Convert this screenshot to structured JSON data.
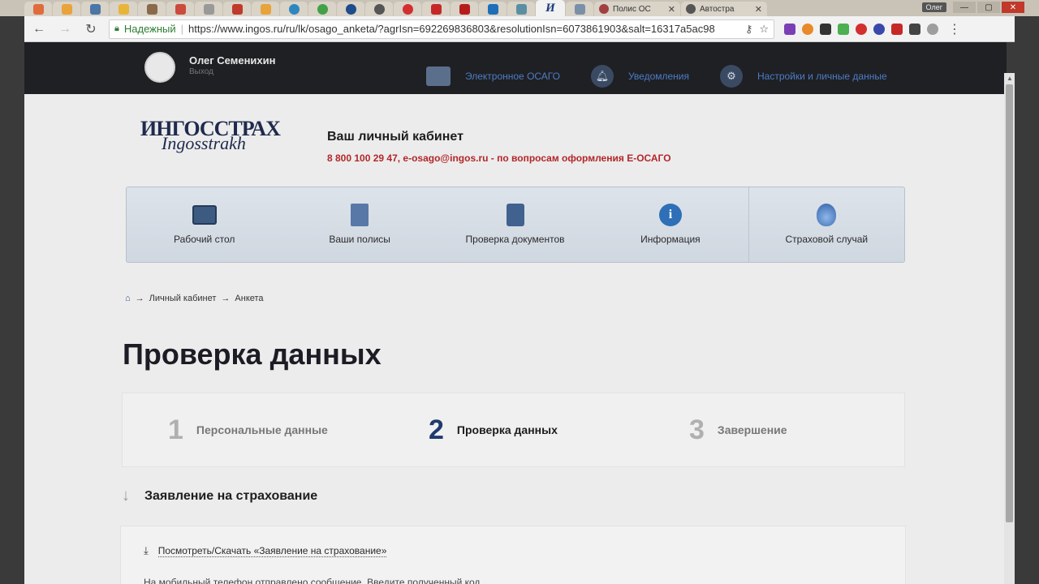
{
  "browser": {
    "tabs": [
      {
        "title": "Полис ОС"
      },
      {
        "title": "Автостра"
      }
    ],
    "active_tab_letter": "И",
    "user_badge": "Олег",
    "security_label": "Надежный",
    "url": "https://www.ingos.ru/ru/lk/osago_anketa/?agrIsn=692269836803&resolutionIsn=6073861903&salt=16317a5ac98"
  },
  "topbar": {
    "user_name": "Олег Семенихин",
    "logout": "Выход",
    "links": [
      {
        "label": "Электронное ОСАГО"
      },
      {
        "label": "Уведомления"
      },
      {
        "label": "Настройки и личные данные"
      }
    ]
  },
  "header": {
    "brand_ru": "ИНГОССТРАХ",
    "brand_en": "Ingosstrakh",
    "title": "Ваш личный кабинет",
    "contacts": "8 800 100 29 47,  e-osago@ingos.ru - по вопросам оформления Е-ОСАГО"
  },
  "nav": [
    {
      "label": "Рабочий стол",
      "icon": "monitor-icon"
    },
    {
      "label": "Ваши полисы",
      "icon": "document-icon"
    },
    {
      "label": "Проверка документов",
      "icon": "calculator-icon"
    },
    {
      "label": "Информация",
      "icon": "info-icon"
    },
    {
      "label": "Страховой случай",
      "icon": "fire-icon"
    }
  ],
  "breadcrumb": {
    "items": [
      "Личный кабинет",
      "Анкета"
    ],
    "separator": "→"
  },
  "page_title": "Проверка данных",
  "steps": [
    {
      "num": "1",
      "label": "Персональные данные",
      "active": false
    },
    {
      "num": "2",
      "label": "Проверка данных",
      "active": true
    },
    {
      "num": "3",
      "label": "Завершение",
      "active": false
    }
  ],
  "section": {
    "title": "Заявление на страхование",
    "download_link": "Посмотреть/Скачать «Заявление на страхование»",
    "sms_text": "На мобильный телефон отправлено сообщение. Введите полученный код"
  }
}
